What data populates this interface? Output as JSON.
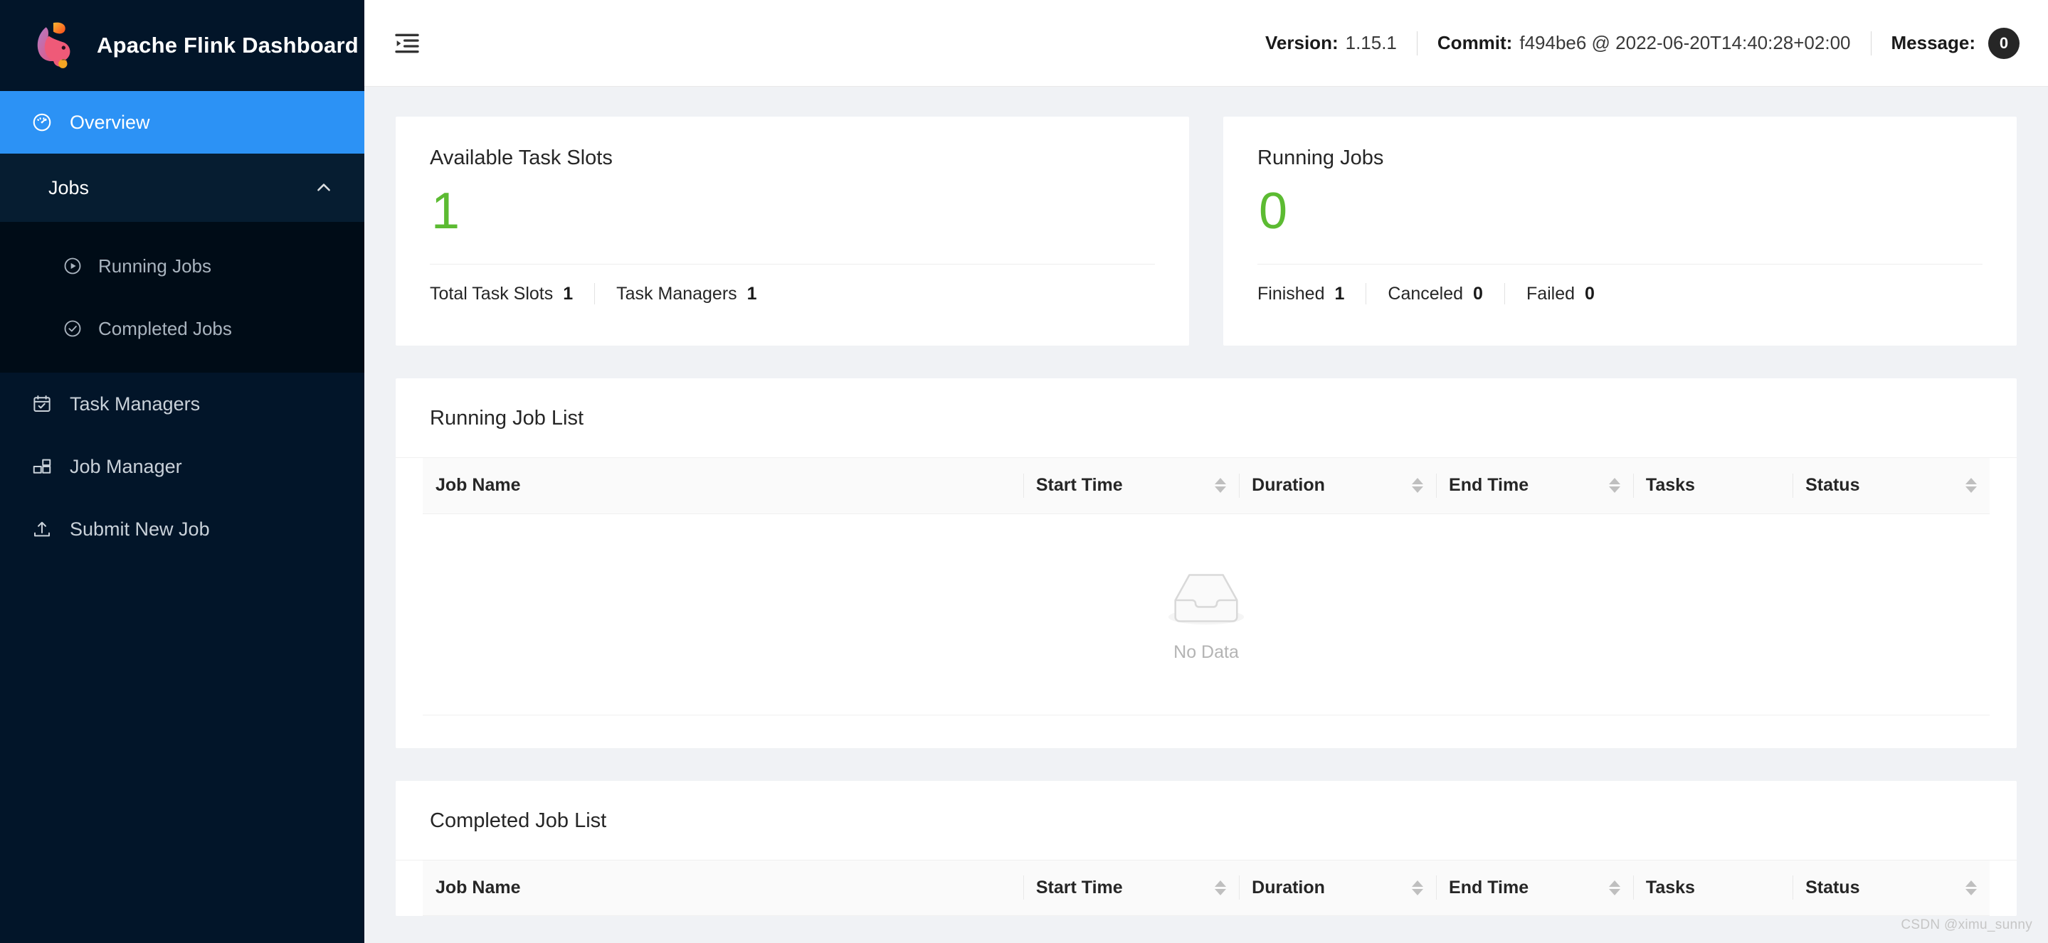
{
  "sidebar": {
    "brand": {
      "title": "Apache Flink Dashboard",
      "logo_icon": "flink-squirrel-logo"
    },
    "items": [
      {
        "label": "Overview",
        "icon": "dashboard-gauge-icon",
        "active": true
      },
      {
        "label": "Jobs",
        "icon": "ordered-list-icon",
        "expanded": true,
        "chevron_icon": "chevron-up-icon"
      },
      {
        "label": "Running Jobs",
        "icon": "play-circle-icon",
        "sub": true
      },
      {
        "label": "Completed Jobs",
        "icon": "check-circle-icon",
        "sub": true
      },
      {
        "label": "Task Managers",
        "icon": "schedule-icon"
      },
      {
        "label": "Job Manager",
        "icon": "blocks-icon"
      },
      {
        "label": "Submit New Job",
        "icon": "upload-icon"
      }
    ]
  },
  "topbar": {
    "fold_icon": "menu-fold-icon",
    "version_label": "Version:",
    "version_value": "1.15.1",
    "commit_label": "Commit:",
    "commit_value": "f494be6 @ 2022-06-20T14:40:28+02:00",
    "message_label": "Message:",
    "message_count": "0"
  },
  "cards": {
    "task_slots": {
      "title": "Available Task Slots",
      "value": "1",
      "value_color": "#5cbb32",
      "footer": [
        {
          "label": "Total Task Slots",
          "value": "1"
        },
        {
          "label": "Task Managers",
          "value": "1"
        }
      ]
    },
    "running_jobs": {
      "title": "Running Jobs",
      "value": "0",
      "value_color": "#5cbb32",
      "footer": [
        {
          "label": "Finished",
          "value": "1"
        },
        {
          "label": "Canceled",
          "value": "0"
        },
        {
          "label": "Failed",
          "value": "0"
        }
      ]
    }
  },
  "running_job_list": {
    "title": "Running Job List",
    "columns": [
      {
        "label": "Job Name",
        "sortable": false
      },
      {
        "label": "Start Time",
        "sortable": true
      },
      {
        "label": "Duration",
        "sortable": true
      },
      {
        "label": "End Time",
        "sortable": true
      },
      {
        "label": "Tasks",
        "sortable": false
      },
      {
        "label": "Status",
        "sortable": true
      }
    ],
    "rows": [],
    "empty_text": "No Data",
    "empty_icon": "empty-inbox-icon"
  },
  "completed_job_list": {
    "title": "Completed Job List",
    "columns": [
      {
        "label": "Job Name",
        "sortable": false
      },
      {
        "label": "Start Time",
        "sortable": true
      },
      {
        "label": "Duration",
        "sortable": true
      },
      {
        "label": "End Time",
        "sortable": true
      },
      {
        "label": "Tasks",
        "sortable": false
      },
      {
        "label": "Status",
        "sortable": true
      }
    ],
    "rows": []
  },
  "watermark": "CSDN @ximu_sunny",
  "theme": {
    "sidebar_bg": "#021529",
    "sidebar_group_bg": "#061d31",
    "submenu_bg": "#000c17",
    "accent_blue": "#2c92f5",
    "page_bg": "#f0f2f5",
    "green": "#5cbb32"
  }
}
